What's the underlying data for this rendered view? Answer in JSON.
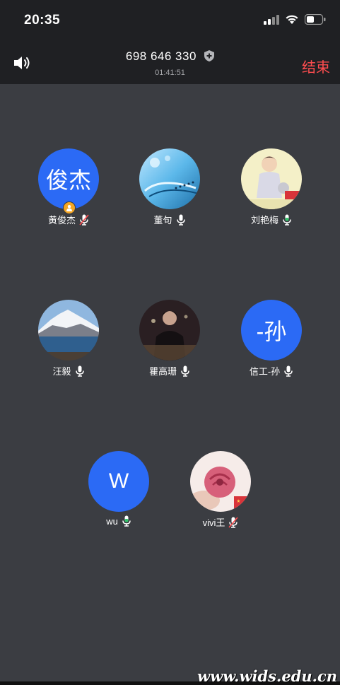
{
  "status_bar": {
    "time": "20:35"
  },
  "header": {
    "meeting_id": "698 646 330",
    "duration": "01:41:51",
    "end_label": "结束"
  },
  "participants": [
    {
      "name": "黄俊杰",
      "avatar_text": "俊杰",
      "mic": "muted",
      "host": true
    },
    {
      "name": "董句",
      "avatar_image": "water-art",
      "mic": "on"
    },
    {
      "name": "刘艳梅",
      "avatar_image": "illustration-child",
      "mic": "on-active"
    },
    {
      "name": "汪毅",
      "avatar_image": "snow-mountain-lake",
      "mic": "on"
    },
    {
      "name": "瞿高珊",
      "avatar_image": "portrait-photo",
      "mic": "on"
    },
    {
      "name": "信工-孙",
      "avatar_text": "-孙",
      "mic": "on"
    },
    {
      "name": "wu",
      "avatar_text": "W",
      "mic": "on-active"
    },
    {
      "name": "vivi王",
      "avatar_image": "pink-rose",
      "mic": "muted"
    }
  ],
  "watermark": "www.wids.edu.cn",
  "colors": {
    "accent_blue": "#2b6af5",
    "end_red": "#ff4d4f",
    "background": "#3b3d42",
    "bar": "#1f2023"
  }
}
